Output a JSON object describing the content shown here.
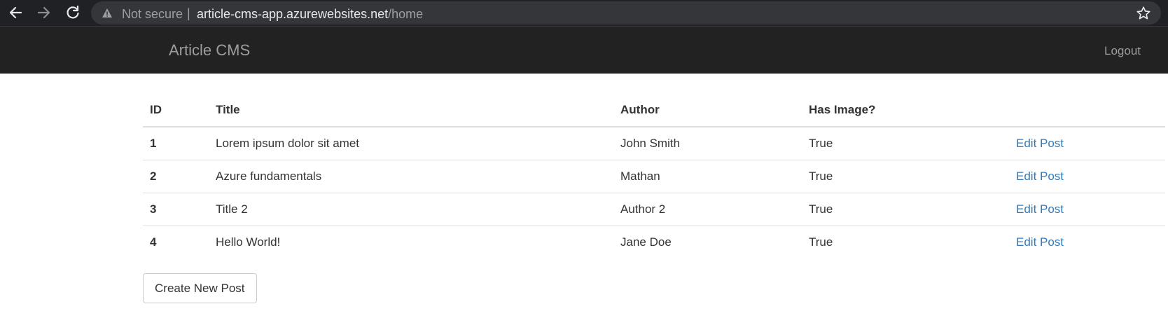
{
  "browser": {
    "security_label": "Not secure",
    "url_host": "article-cms-app.azurewebsites.net",
    "url_path": "/home"
  },
  "navbar": {
    "brand": "Article CMS",
    "logout_label": "Logout"
  },
  "table": {
    "headers": [
      "ID",
      "Title",
      "Author",
      "Has Image?",
      ""
    ],
    "rows": [
      {
        "id": "1",
        "title": "Lorem ipsum dolor sit amet",
        "author": "John Smith",
        "has_image": "True",
        "action": "Edit Post"
      },
      {
        "id": "2",
        "title": "Azure fundamentals",
        "author": "Mathan",
        "has_image": "True",
        "action": "Edit Post"
      },
      {
        "id": "3",
        "title": "Title 2",
        "author": "Author 2",
        "has_image": "True",
        "action": "Edit Post"
      },
      {
        "id": "4",
        "title": "Hello World!",
        "author": "Jane Doe",
        "has_image": "True",
        "action": "Edit Post"
      }
    ]
  },
  "create_button_label": "Create New Post",
  "colors": {
    "navbar_bg": "#222222",
    "link": "#337ab7",
    "browser_bg": "#202124"
  },
  "icons": [
    "back-arrow-icon",
    "forward-arrow-icon",
    "reload-icon",
    "warning-icon",
    "star-icon"
  ]
}
